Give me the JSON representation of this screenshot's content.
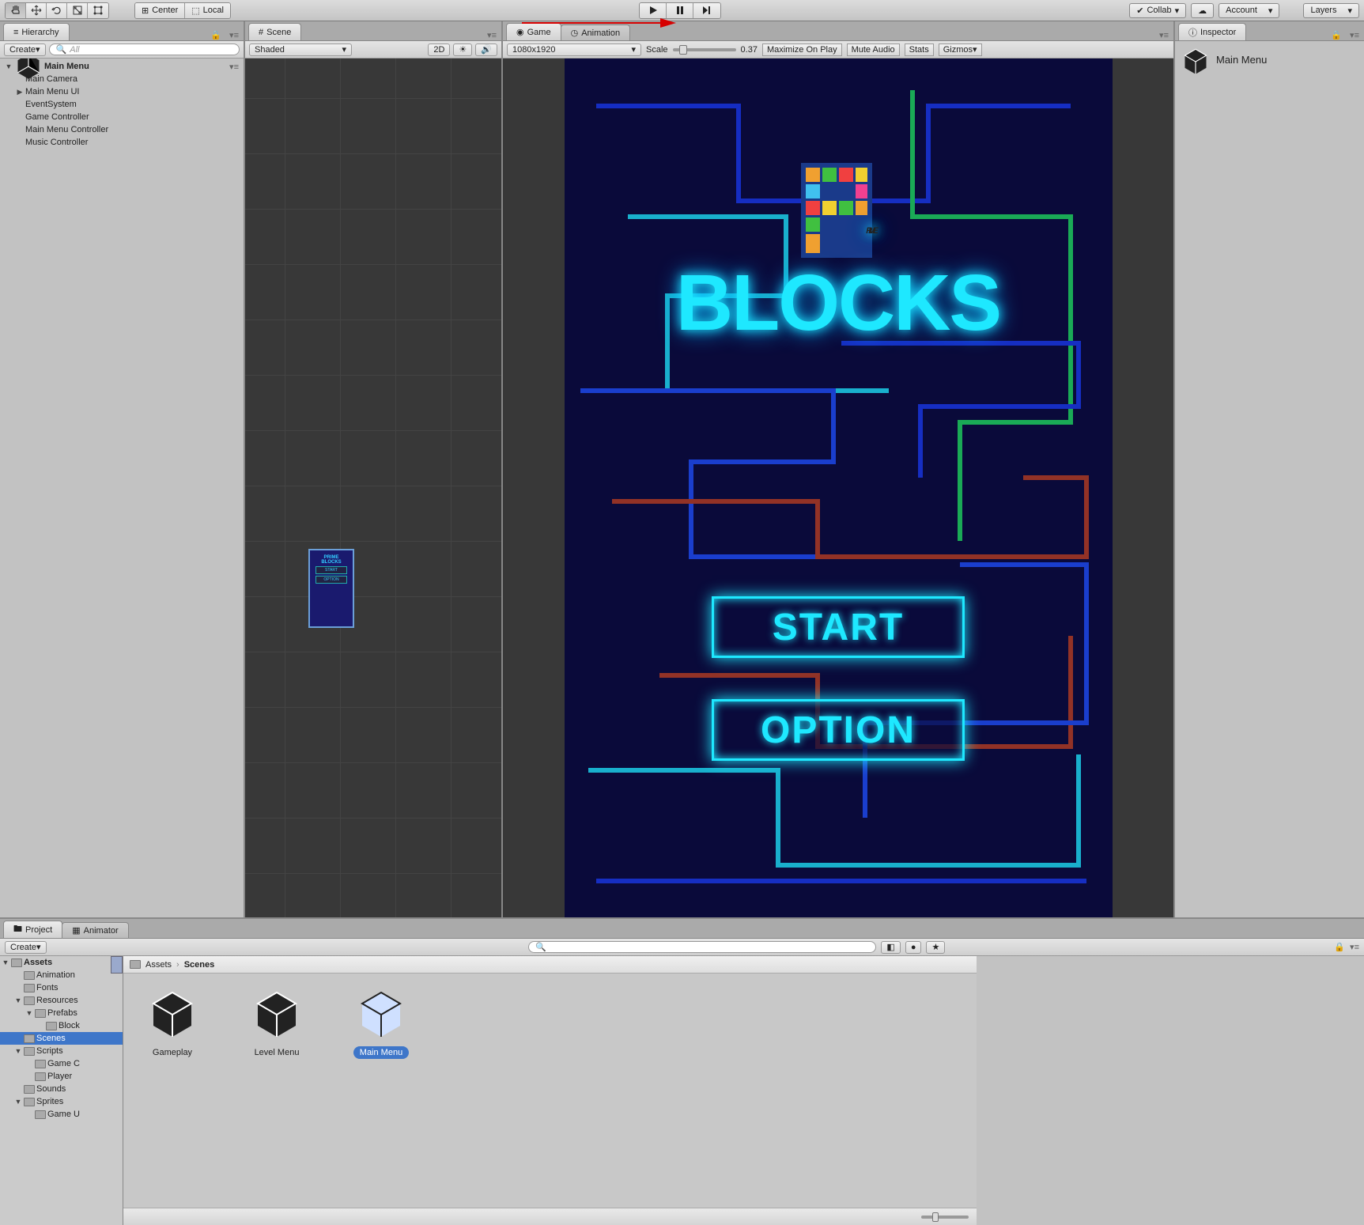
{
  "toolbar": {
    "center": "Center",
    "local": "Local",
    "collab": "Collab",
    "account": "Account",
    "layers": "Layers"
  },
  "hierarchy": {
    "tab": "Hierarchy",
    "create": "Create",
    "search_placeholder": "All",
    "root": "Main Menu",
    "items": [
      "Main Camera",
      "Main Menu UI",
      "EventSystem",
      "Game Controller",
      "Main Menu Controller",
      "Music Controller"
    ]
  },
  "scene": {
    "tab": "Scene",
    "shaded": "Shaded",
    "twoD": "2D"
  },
  "gameTab": {
    "game": "Game",
    "animation": "Animation"
  },
  "gameBar": {
    "resolution": "1080x1920",
    "scaleLabel": "Scale",
    "scaleValue": "0.37",
    "maximize": "Maximize On Play",
    "mute": "Mute Audio",
    "stats": "Stats",
    "gizmos": "Gizmos"
  },
  "gameScreen": {
    "title_line1": "RIME",
    "title_line2": "BLOCKS",
    "start": "START",
    "option": "OPTION"
  },
  "inspector": {
    "tab": "Inspector",
    "title": "Main Menu"
  },
  "project": {
    "projectTab": "Project",
    "animatorTab": "Animator",
    "create": "Create",
    "tree": {
      "root": "Assets",
      "items": [
        {
          "name": "Animation",
          "depth": 1,
          "expand": ""
        },
        {
          "name": "Fonts",
          "depth": 1,
          "expand": ""
        },
        {
          "name": "Resources",
          "depth": 1,
          "expand": "▼"
        },
        {
          "name": "Prefabs",
          "depth": 2,
          "expand": "▼"
        },
        {
          "name": "Block",
          "depth": 3,
          "expand": ""
        },
        {
          "name": "Scenes",
          "depth": 1,
          "expand": "",
          "sel": true
        },
        {
          "name": "Scripts",
          "depth": 1,
          "expand": "▼"
        },
        {
          "name": "Game C",
          "depth": 2,
          "expand": ""
        },
        {
          "name": "Player",
          "depth": 2,
          "expand": ""
        },
        {
          "name": "Sounds",
          "depth": 1,
          "expand": ""
        },
        {
          "name": "Sprites",
          "depth": 1,
          "expand": "▼"
        },
        {
          "name": "Game U",
          "depth": 2,
          "expand": ""
        }
      ]
    },
    "breadcrumb": [
      "Assets",
      "Scenes"
    ],
    "assets": [
      {
        "name": "Gameplay",
        "sel": false
      },
      {
        "name": "Level Menu",
        "sel": false
      },
      {
        "name": "Main Menu",
        "sel": true
      }
    ]
  }
}
